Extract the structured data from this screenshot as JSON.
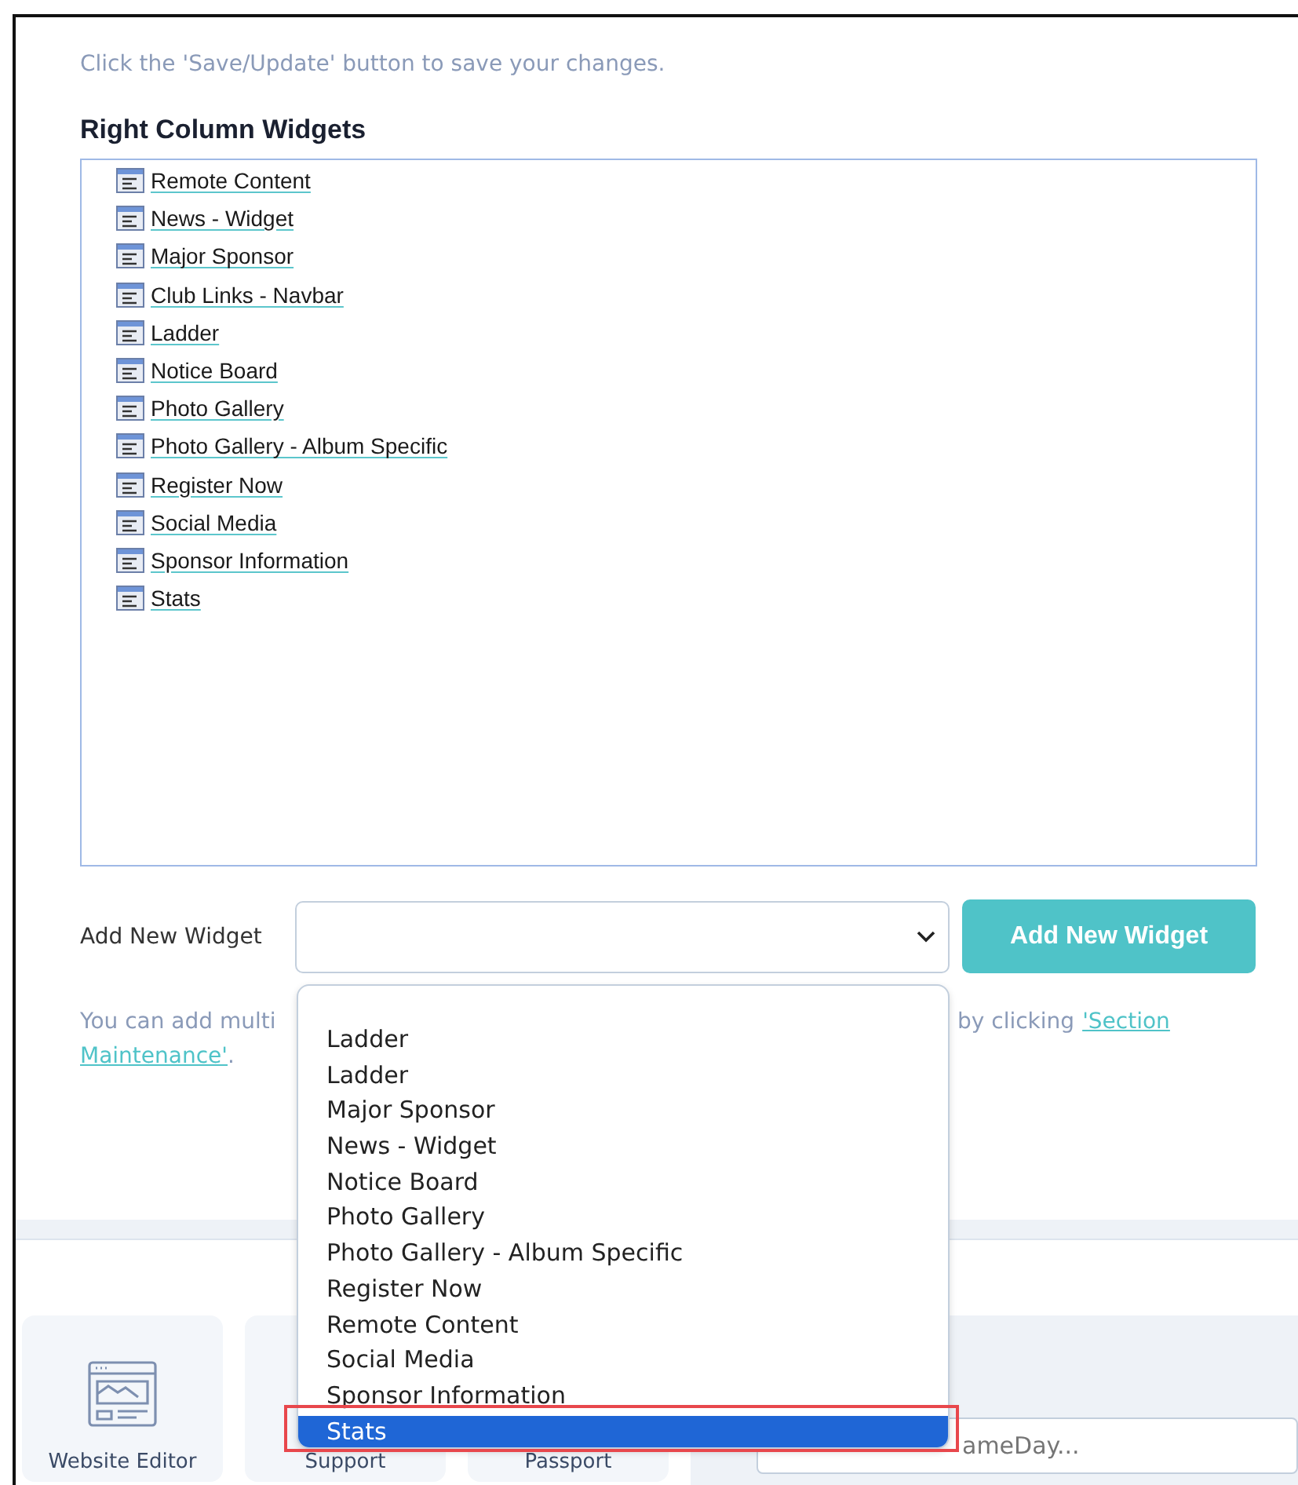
{
  "instructions": "Click the 'Save/Update' button to save your changes.",
  "widgets_panel": {
    "title": "Right Column Widgets",
    "items": [
      {
        "label": "Remote Content"
      },
      {
        "label": "News - Widget"
      },
      {
        "label": "Major Sponsor"
      },
      {
        "label": "Club Links - Navbar"
      },
      {
        "label": "Ladder"
      },
      {
        "label": "Notice Board"
      },
      {
        "label": "Photo Gallery"
      },
      {
        "label": "Photo Gallery - Album Specific"
      },
      {
        "label": "Register Now"
      },
      {
        "label": "Social Media"
      },
      {
        "label": "Sponsor Information"
      },
      {
        "label": "Stats"
      }
    ]
  },
  "add_widget": {
    "label": "Add New Widget",
    "button": "Add New Widget",
    "options": [
      {
        "label": "Ladder",
        "selected": false
      },
      {
        "label": "Ladder",
        "selected": false
      },
      {
        "label": "Major Sponsor",
        "selected": false
      },
      {
        "label": "News - Widget",
        "selected": false
      },
      {
        "label": "Notice Board",
        "selected": false
      },
      {
        "label": "Photo Gallery",
        "selected": false
      },
      {
        "label": "Photo Gallery - Album Specific",
        "selected": false
      },
      {
        "label": "Register Now",
        "selected": false
      },
      {
        "label": "Remote Content",
        "selected": false
      },
      {
        "label": "Social Media",
        "selected": false
      },
      {
        "label": "Sponsor Information",
        "selected": false
      },
      {
        "label": "Stats",
        "selected": true
      }
    ]
  },
  "hint": {
    "start": "You can add multi",
    "end": "by clicking",
    "link_lines": [
      "'Section",
      "Maintenance'"
    ],
    "tail": "."
  },
  "bottom_tiles": [
    {
      "label": "Website Editor",
      "kind": "editor"
    },
    {
      "label": "Support",
      "kind": "plain"
    },
    {
      "label": "Passport",
      "kind": "plain"
    }
  ],
  "search": {
    "placeholder": "ameDay..."
  }
}
